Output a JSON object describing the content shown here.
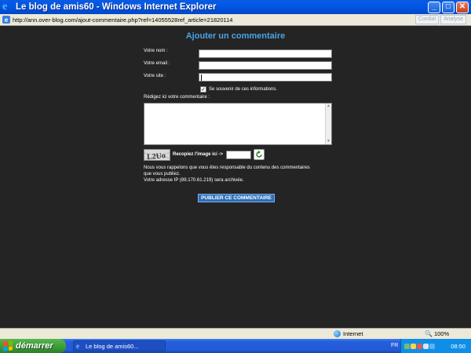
{
  "window": {
    "title": "Le blog de amis60 - Windows Internet Explorer",
    "minimize_glyph": "_",
    "maximize_glyph": "□",
    "close_glyph": "✕"
  },
  "toolbar_ghost": [
    "Cordial",
    "Analyse"
  ],
  "address": {
    "url": "http://ann.over-blog.com/ajout-commentaire.php?ref=14055528ref_article=21820114"
  },
  "form": {
    "heading": "Ajouter un commentaire",
    "name_label": "Votre nom :",
    "email_label": "Votre email :",
    "site_label": "Votre site :",
    "remember_label": "Se souvenir de ces informations.",
    "remember_checked": true,
    "comment_label": "Rédigez ici votre commentaire :",
    "captcha_text": "L2Uo",
    "captcha_label": "Recopiez l'image ici ->",
    "notice_line1": "Nous vous rappelons que vous êtes responsable du contenu des commentaires",
    "notice_line2": "que vous publiez.",
    "notice_line3": "Votre adresse IP (89.170.61.219) sera archivée.",
    "publish_label": "PUBLIER CE COMMENTAIRE"
  },
  "statusbar": {
    "zone": "Internet",
    "zoom": "100%"
  },
  "taskbar": {
    "start_label": "démarrer",
    "task_label": "Le blog de amis60...",
    "language": "FR",
    "clock": "08:50"
  },
  "colors": {
    "page_background": "#242424",
    "heading": "#4aa3e6",
    "publish_button": "#2e6fb8"
  }
}
